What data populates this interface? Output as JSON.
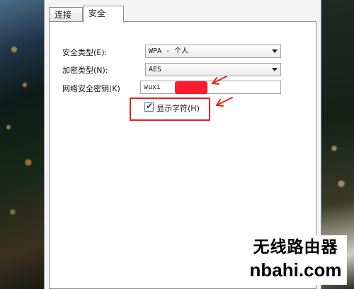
{
  "tabs": [
    {
      "label": "连接"
    },
    {
      "label": "安全"
    }
  ],
  "form": {
    "security_type": {
      "label": "安全类型(E):",
      "value": "WPA - 个人"
    },
    "encryption_type": {
      "label": "加密类型(N):",
      "value": "AES"
    },
    "network_key": {
      "label": "网络安全密钥(K)",
      "value": "wuxi"
    },
    "show_chars": {
      "label": "显示字符(H)",
      "checked": true
    }
  },
  "watermark": {
    "line1": "无线路由器",
    "line2": "nbahi.com"
  },
  "colors": {
    "annotation": "#e3231d",
    "redaction": "#ff1c2e"
  }
}
